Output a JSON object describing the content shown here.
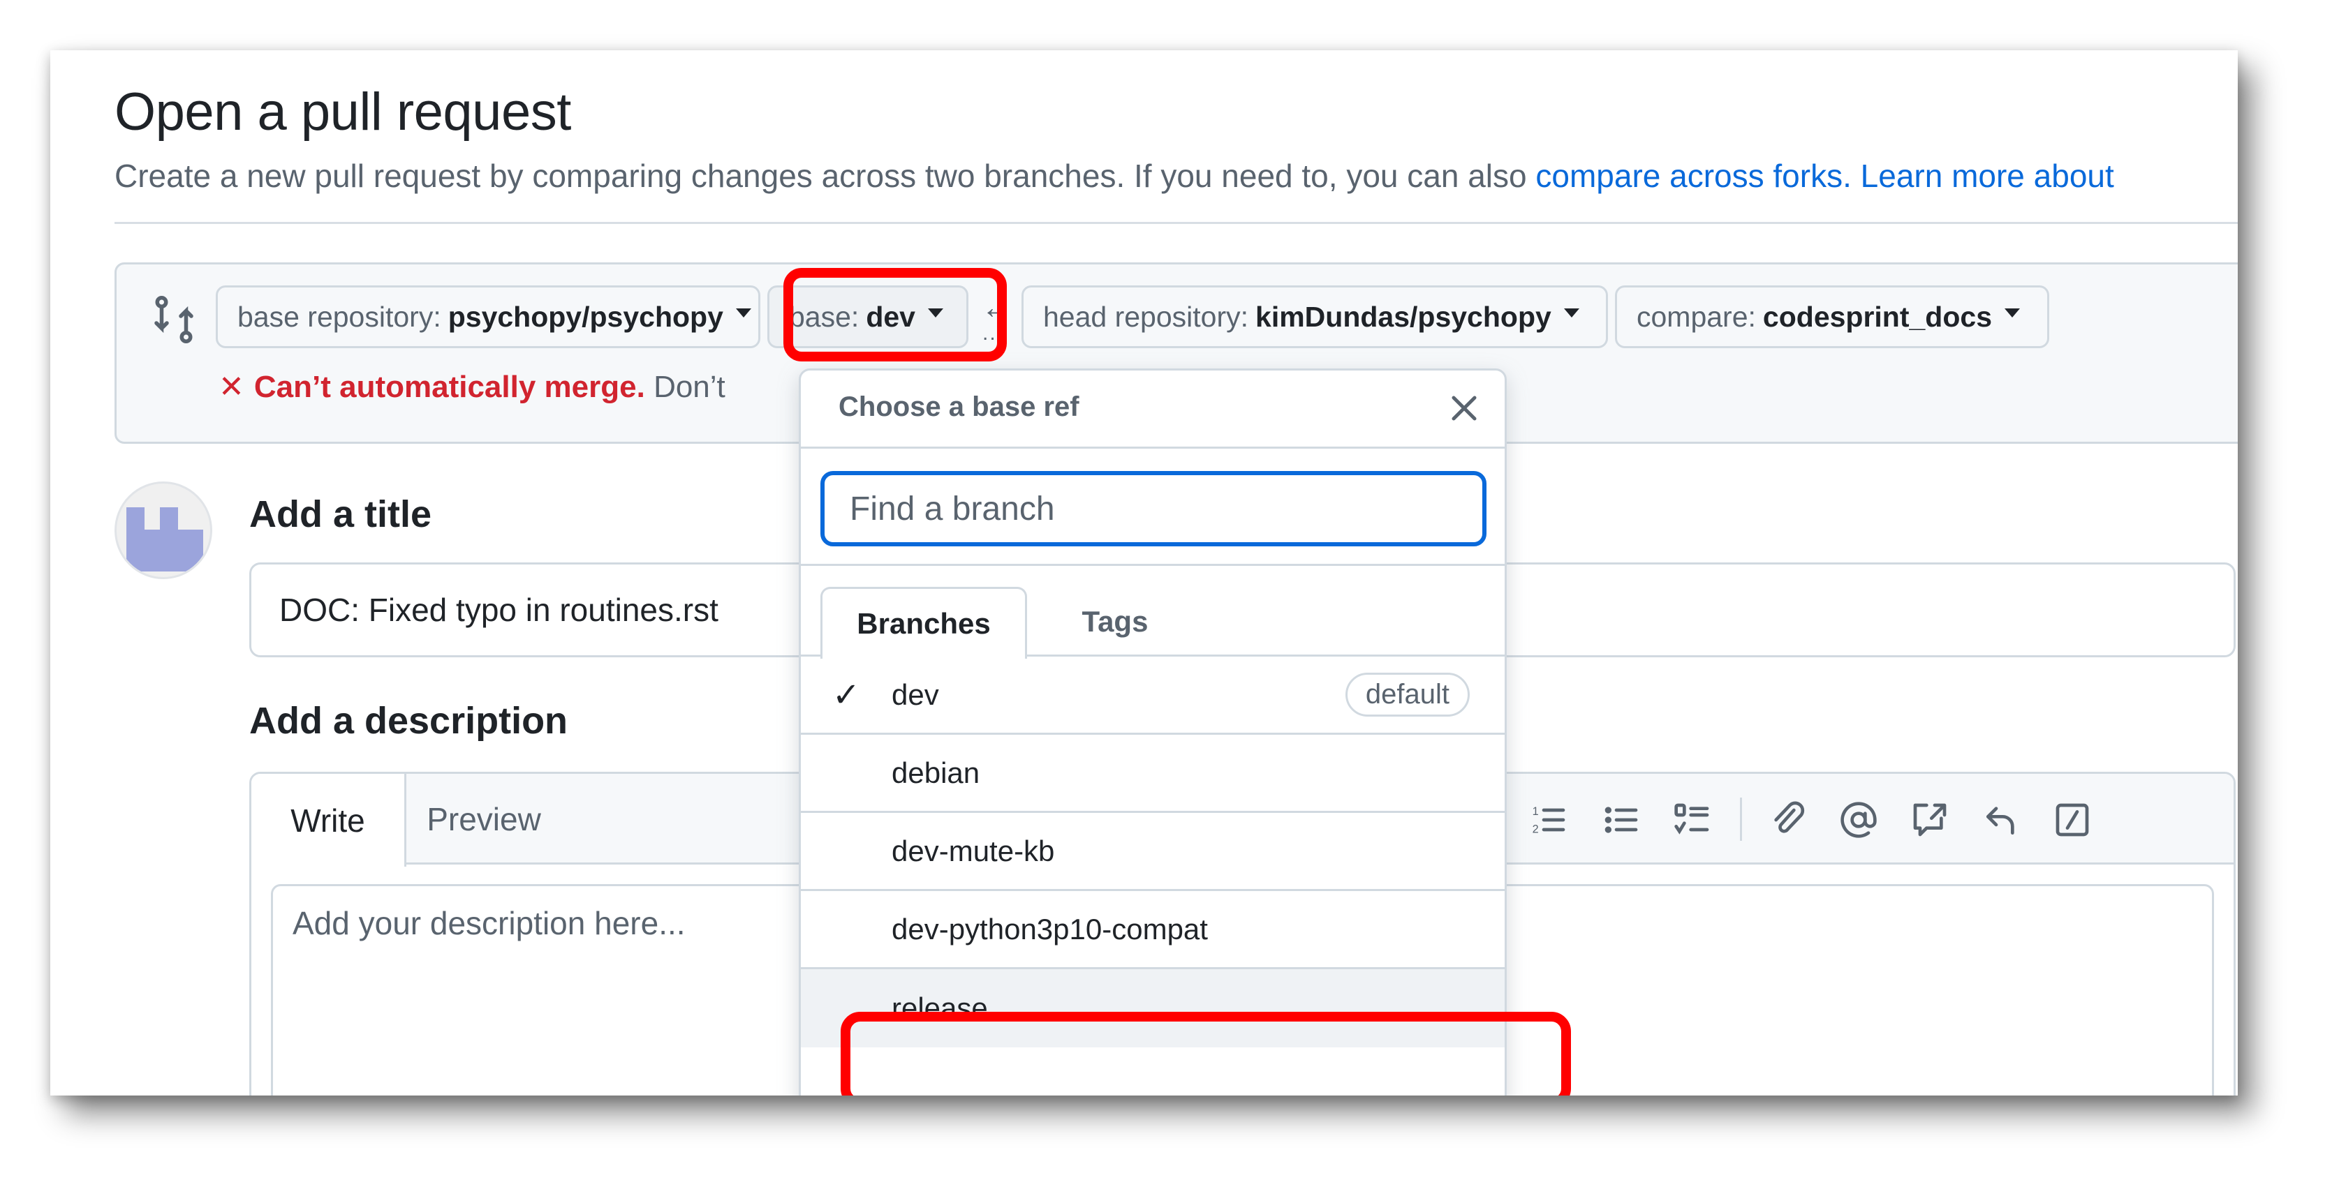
{
  "page": {
    "title": "Open a pull request",
    "subtitle_text": "Create a new pull request by comparing changes across two branches. If you need to, you can also ",
    "subtitle_link1": "compare across forks.",
    "subtitle_link2": "Learn more about"
  },
  "compare": {
    "icon": "git-compare-icon",
    "base_repo_label": "base repository:",
    "base_repo_value": "psychopy/psychopy",
    "base_label": "base:",
    "base_value": "dev",
    "arrow": "←",
    "dots": "...",
    "head_repo_label": "head repository:",
    "head_repo_value": "kimDundas/psychopy",
    "compare_label": "compare:",
    "compare_value": "codesprint_docs",
    "merge_icon": "x-icon",
    "merge_x": "✕",
    "merge_status": "Can’t automatically merge.",
    "merge_hint": "Don’t"
  },
  "form": {
    "title_heading": "Add a title",
    "title_value": "DOC: Fixed typo in routines.rst",
    "desc_heading": "Add a description",
    "tab_write": "Write",
    "tab_preview": "Preview",
    "desc_placeholder": "Add your description here...",
    "toolbar": [
      "ordered-list-icon",
      "unordered-list-icon",
      "task-list-icon",
      "attach-icon",
      "mention-icon",
      "cross-reference-icon",
      "reply-icon",
      "slash-command-icon"
    ]
  },
  "dropdown": {
    "title": "Choose a base ref",
    "close_icon": "close-icon",
    "search_placeholder": "Find a branch",
    "tab_branches": "Branches",
    "tab_tags": "Tags",
    "items": [
      {
        "name": "dev",
        "checked": "✓",
        "badge": "default"
      },
      {
        "name": "debian",
        "checked": "",
        "badge": ""
      },
      {
        "name": "dev-mute-kb",
        "checked": "",
        "badge": ""
      },
      {
        "name": "dev-python3p10-compat",
        "checked": "",
        "badge": ""
      },
      {
        "name": "release",
        "checked": "",
        "badge": ""
      }
    ]
  },
  "annotations": {
    "highlight_color": "#ff0000"
  }
}
